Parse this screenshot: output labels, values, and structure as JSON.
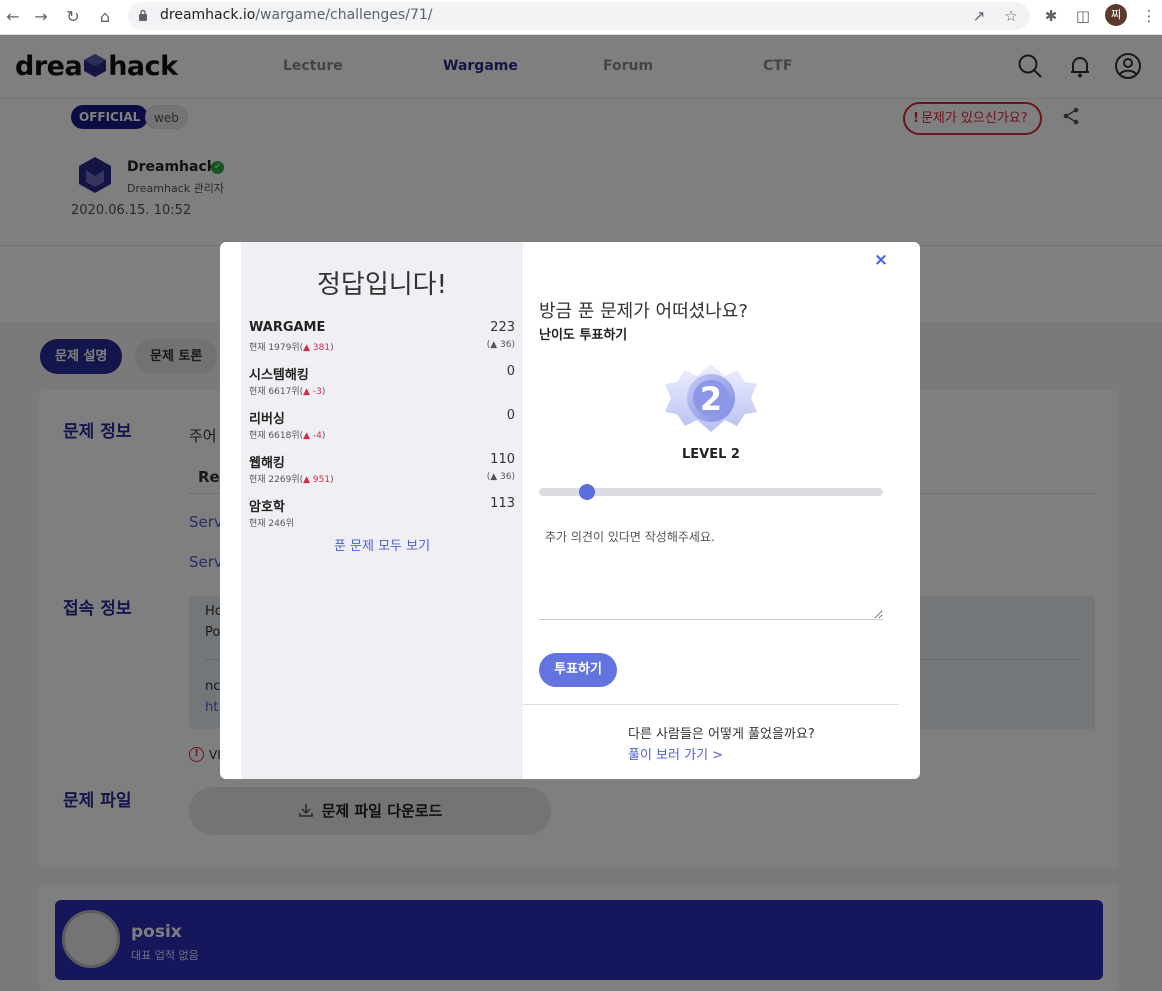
{
  "browser": {
    "url_host": "dreamhack.io",
    "url_path": "/wargame/challenges/71/",
    "profile_initial": "찌"
  },
  "header": {
    "logo_left": "drea",
    "logo_right": "hack",
    "nav": [
      "Lecture",
      "Wargame",
      "Forum",
      "CTF"
    ],
    "active_nav": "Wargame"
  },
  "challenge": {
    "tags": [
      "OFFICIAL",
      "web"
    ],
    "report_label": "문제가 있으신가요?",
    "report_mark": "!",
    "author_name": "Dreamhack",
    "author_role": "Dreamhack 관리자",
    "date": "2020.06.15. 10:52",
    "tabs": [
      "문제 설명",
      "문제 토론"
    ],
    "sections": {
      "info": "문제 정보",
      "connection": "접속 정보",
      "file": "문제 파일"
    },
    "fragments": {
      "desc_start": "주어",
      "ref": "Ref",
      "serv1": "Serv",
      "serv2": "Serv",
      "ho": "Ho",
      "po": "Po",
      "nc": "nc",
      "ht": "ht",
      "vi": "VI"
    },
    "download_label": "문제 파일 다운로드"
  },
  "profile_card": {
    "name": "posix",
    "subtitle": "대표 업적 없음"
  },
  "modal": {
    "title": "정답입니다!",
    "scores": [
      {
        "category": "WARGAME",
        "rank_prefix": "현재 1979위(",
        "rank_change": "▲ 381",
        "rank_suffix": ")",
        "points": "223",
        "delta": "(▲ 36)"
      },
      {
        "category": "시스템해킹",
        "rank_prefix": "현재 6617위(",
        "rank_change": "▲ -3",
        "rank_suffix": ")",
        "points": "0",
        "delta": ""
      },
      {
        "category": "리버싱",
        "rank_prefix": "현재 6618위(",
        "rank_change": "▲ -4",
        "rank_suffix": ")",
        "points": "0",
        "delta": ""
      },
      {
        "category": "웹해킹",
        "rank_prefix": "현재 2269위(",
        "rank_change": "▲ 951",
        "rank_suffix": ")",
        "points": "110",
        "delta": "(▲ 36)"
      },
      {
        "category": "암호학",
        "rank_prefix": "현재 246위",
        "rank_change": "",
        "rank_suffix": "",
        "points": "113",
        "delta": ""
      }
    ],
    "view_all": "푼 문제 모두 보기",
    "close": "×",
    "question": "방금 푼 문제가 어떠셨나요?",
    "vote_heading": "난이도 투표하기",
    "level_number": "2",
    "level_label": "LEVEL 2",
    "level_value": 2,
    "level_max": 10,
    "opinion_placeholder": "추가 의견이 있다면 작성해주세요.",
    "vote_button": "투표하기",
    "others_question": "다른 사람들은 어떻게 풀었을까요?",
    "others_link": "풀이 보러 가기 >"
  }
}
